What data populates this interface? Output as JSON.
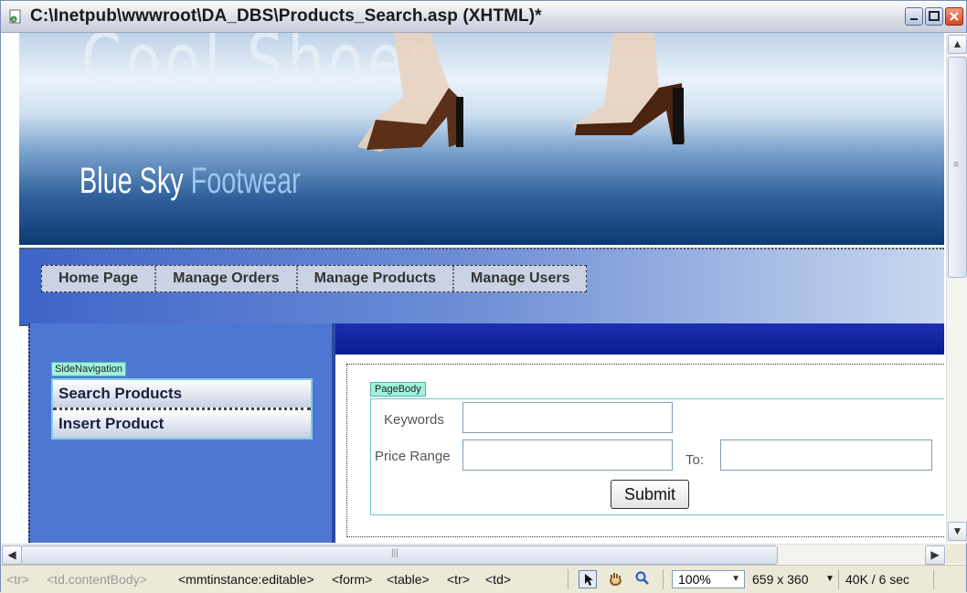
{
  "window": {
    "title": "C:\\Inetpub\\wwwroot\\DA_DBS\\Products_Search.asp (XHTML)*"
  },
  "banner": {
    "ghost_text": "Cool Shoes",
    "brand_part1": "Blue Sky",
    "brand_part2": "Footwear"
  },
  "nav": {
    "items": [
      {
        "label": "Home Page"
      },
      {
        "label": "Manage Orders"
      },
      {
        "label": "Manage Products"
      },
      {
        "label": "Manage Users"
      }
    ]
  },
  "sidebar": {
    "region_tag": "SideNavigation",
    "items": [
      {
        "label": "Search Products"
      },
      {
        "label": "Insert Product"
      }
    ]
  },
  "page_body": {
    "region_tag": "PageBody",
    "keywords_label": "Keywords",
    "price_range_label": "Price Range",
    "to_label": "To:",
    "keywords_value": "",
    "price_from_value": "",
    "price_to_value": "",
    "submit_label": "Submit"
  },
  "status": {
    "tags": [
      "<tr>",
      "<td.contentBody>",
      "<mmtinstance:editable>",
      "<form>",
      "<table>",
      "<tr>",
      "<td>"
    ],
    "zoom": "100%",
    "dimensions": "659 x 360",
    "size_time": "40K / 6 sec"
  },
  "colors": {
    "navy": "#0c3a72",
    "sidebar_blue": "#4e77d4",
    "region_tag": "#9ff2de"
  }
}
